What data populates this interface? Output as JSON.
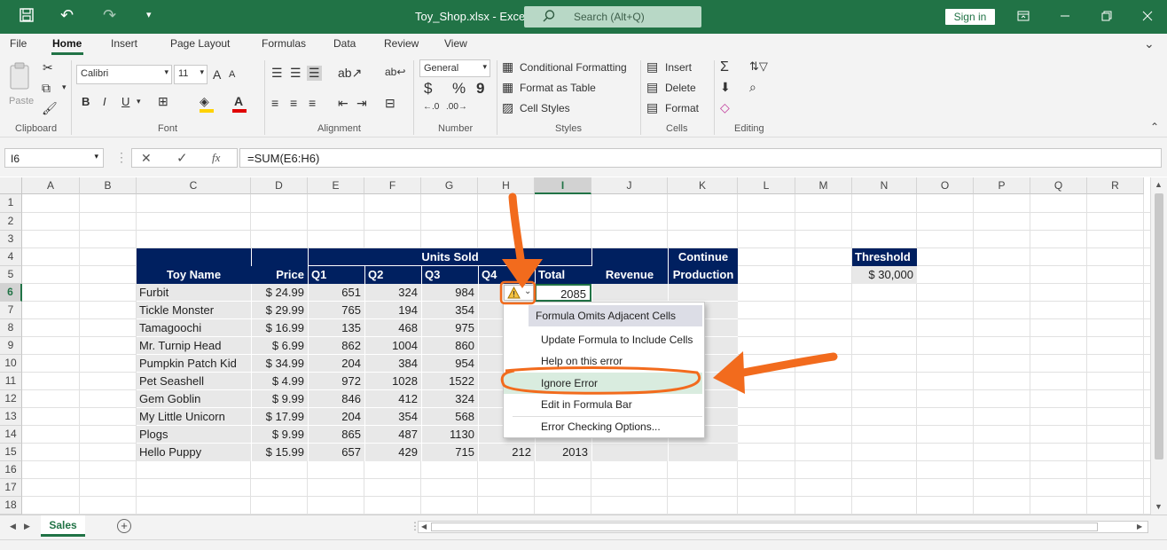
{
  "app": {
    "title": "Toy_Shop.xlsx - Excel",
    "search_placeholder": "Search (Alt+Q)",
    "sign_in": "Sign in"
  },
  "menu_tabs": [
    "File",
    "Home",
    "Insert",
    "Page Layout",
    "Formulas",
    "Data",
    "Review",
    "View"
  ],
  "ribbon": {
    "clipboard": {
      "paste": "Paste",
      "label": "Clipboard"
    },
    "font": {
      "name": "Calibri",
      "size": "11",
      "label": "Font",
      "bold": "B",
      "italic": "I",
      "underline": "U",
      "grow": "A",
      "shrink": "A"
    },
    "alignment": {
      "label": "Alignment"
    },
    "number": {
      "format": "General",
      "label": "Number",
      "currency": "$",
      "percent": "%",
      "comma": "9"
    },
    "styles": {
      "conditional": "Conditional Formatting",
      "format_table": "Format as Table",
      "cell_styles": "Cell Styles",
      "label": "Styles"
    },
    "cells": {
      "insert": "Insert",
      "delete": "Delete",
      "format": "Format",
      "label": "Cells"
    },
    "editing": {
      "label": "Editing"
    }
  },
  "formula_bar": {
    "name_box": "I6",
    "formula": "=SUM(E6:H6)",
    "fx": "fx"
  },
  "columns": [
    "A",
    "B",
    "C",
    "D",
    "E",
    "F",
    "G",
    "H",
    "I",
    "J",
    "K",
    "L",
    "M",
    "N",
    "O",
    "P",
    "Q",
    "R"
  ],
  "rows": [
    "1",
    "2",
    "3",
    "4",
    "5",
    "6",
    "7",
    "8",
    "9",
    "10",
    "11",
    "12",
    "13",
    "14",
    "15",
    "16",
    "17",
    "18"
  ],
  "table": {
    "units_sold": "Units Sold",
    "continue": "Continue",
    "production": "Production",
    "headers": {
      "toy_name": "Toy Name",
      "price": "Price",
      "q1": "Q1",
      "q2": "Q2",
      "q3": "Q3",
      "q4": "Q4",
      "total": "Total",
      "revenue": "Revenue"
    },
    "rows": [
      {
        "name": "Furbit",
        "price": "$ 24.99",
        "q1": "651",
        "q2": "324",
        "q3": "984",
        "q4": "",
        "total": "2085"
      },
      {
        "name": "Tickle Monster",
        "price": "$ 29.99",
        "q1": "765",
        "q2": "194",
        "q3": "354",
        "q4": "",
        "total": ""
      },
      {
        "name": "Tamagoochi",
        "price": "$ 16.99",
        "q1": "135",
        "q2": "468",
        "q3": "975",
        "q4": "",
        "total": ""
      },
      {
        "name": "Mr. Turnip Head",
        "price": "$ 6.99",
        "q1": "862",
        "q2": "1004",
        "q3": "860",
        "q4": "",
        "total": ""
      },
      {
        "name": "Pumpkin Patch Kid",
        "price": "$ 34.99",
        "q1": "204",
        "q2": "384",
        "q3": "954",
        "q4": "",
        "total": ""
      },
      {
        "name": "Pet Seashell",
        "price": "$ 4.99",
        "q1": "972",
        "q2": "1028",
        "q3": "1522",
        "q4": "",
        "total": ""
      },
      {
        "name": "Gem Goblin",
        "price": "$ 9.99",
        "q1": "846",
        "q2": "412",
        "q3": "324",
        "q4": "",
        "total": ""
      },
      {
        "name": "My Little Unicorn",
        "price": "$ 17.99",
        "q1": "204",
        "q2": "354",
        "q3": "568",
        "q4": "",
        "total": ""
      },
      {
        "name": "Plogs",
        "price": "$ 9.99",
        "q1": "865",
        "q2": "487",
        "q3": "1130",
        "q4": "",
        "total": ""
      },
      {
        "name": "Hello Puppy",
        "price": "$ 15.99",
        "q1": "657",
        "q2": "429",
        "q3": "715",
        "q4": "212",
        "total": "2013"
      }
    ],
    "threshold_label": "Threshold",
    "threshold_value": "$ 30,000"
  },
  "context_menu": {
    "title": "Formula Omits Adjacent Cells",
    "items": [
      "Update Formula to Include Cells",
      "Help on this error",
      "Ignore Error",
      "Edit in Formula Bar",
      "Error Checking Options..."
    ]
  },
  "sheet_tabs": [
    "Sales"
  ],
  "colors": {
    "excel_green": "#217346",
    "header_navy": "#002060",
    "annotation_orange": "#f26b1d"
  }
}
